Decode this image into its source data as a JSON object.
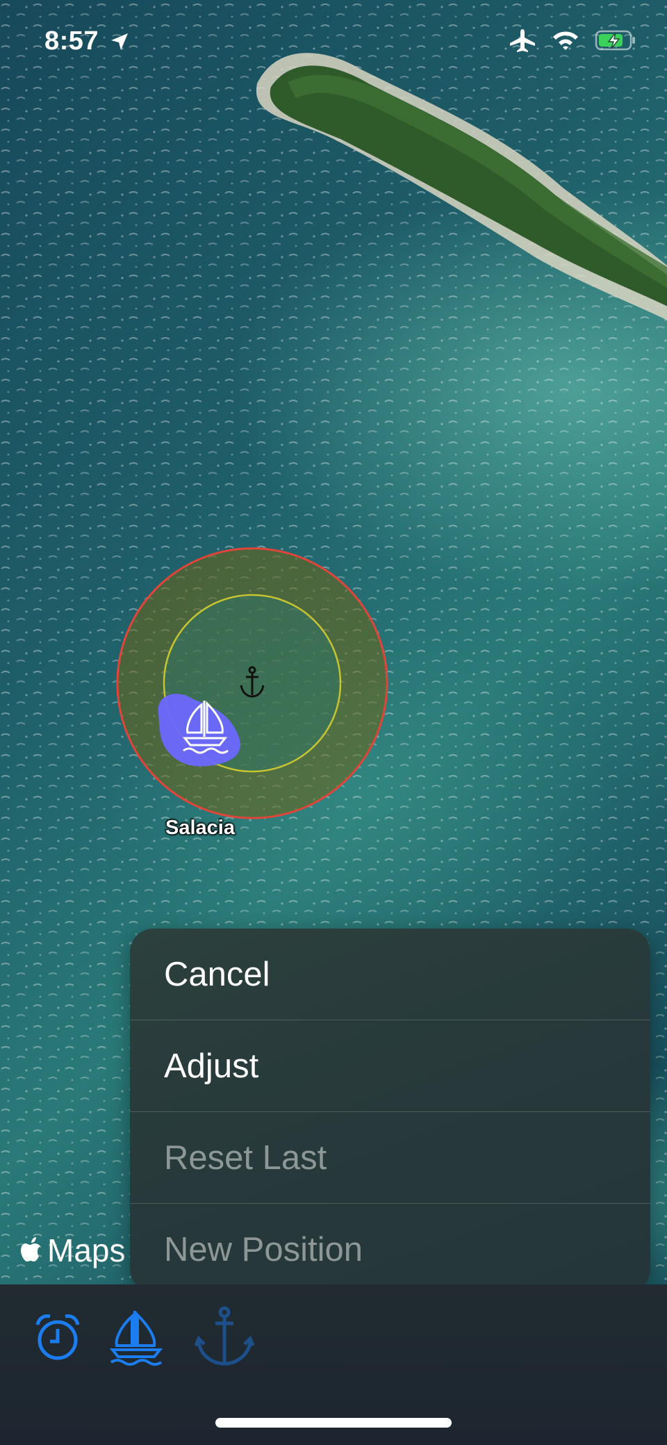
{
  "status_bar": {
    "time": "8:57",
    "icons": [
      "location-arrow-icon",
      "airplane-icon",
      "wifi-icon",
      "battery-charging-icon"
    ]
  },
  "map": {
    "boat_label": "Salacia",
    "brand_label": "Maps",
    "colors": {
      "alarm_circle": "#e0453a",
      "inner_circle": "#c7c432",
      "boat_marker": "#6b68ff"
    }
  },
  "menu": {
    "items": [
      {
        "label": "Cancel",
        "enabled": true
      },
      {
        "label": "Adjust",
        "enabled": true
      },
      {
        "label": "Reset Last",
        "enabled": false
      },
      {
        "label": "New Position",
        "enabled": false
      }
    ]
  },
  "tab_bar": {
    "items": [
      {
        "icon": "alarm-clock-icon",
        "active": true
      },
      {
        "icon": "sailboat-icon",
        "active": true
      },
      {
        "icon": "anchor-icon",
        "active": false
      }
    ],
    "colors": {
      "active": "#1c7df0",
      "inactive": "#1d4f8a"
    }
  }
}
